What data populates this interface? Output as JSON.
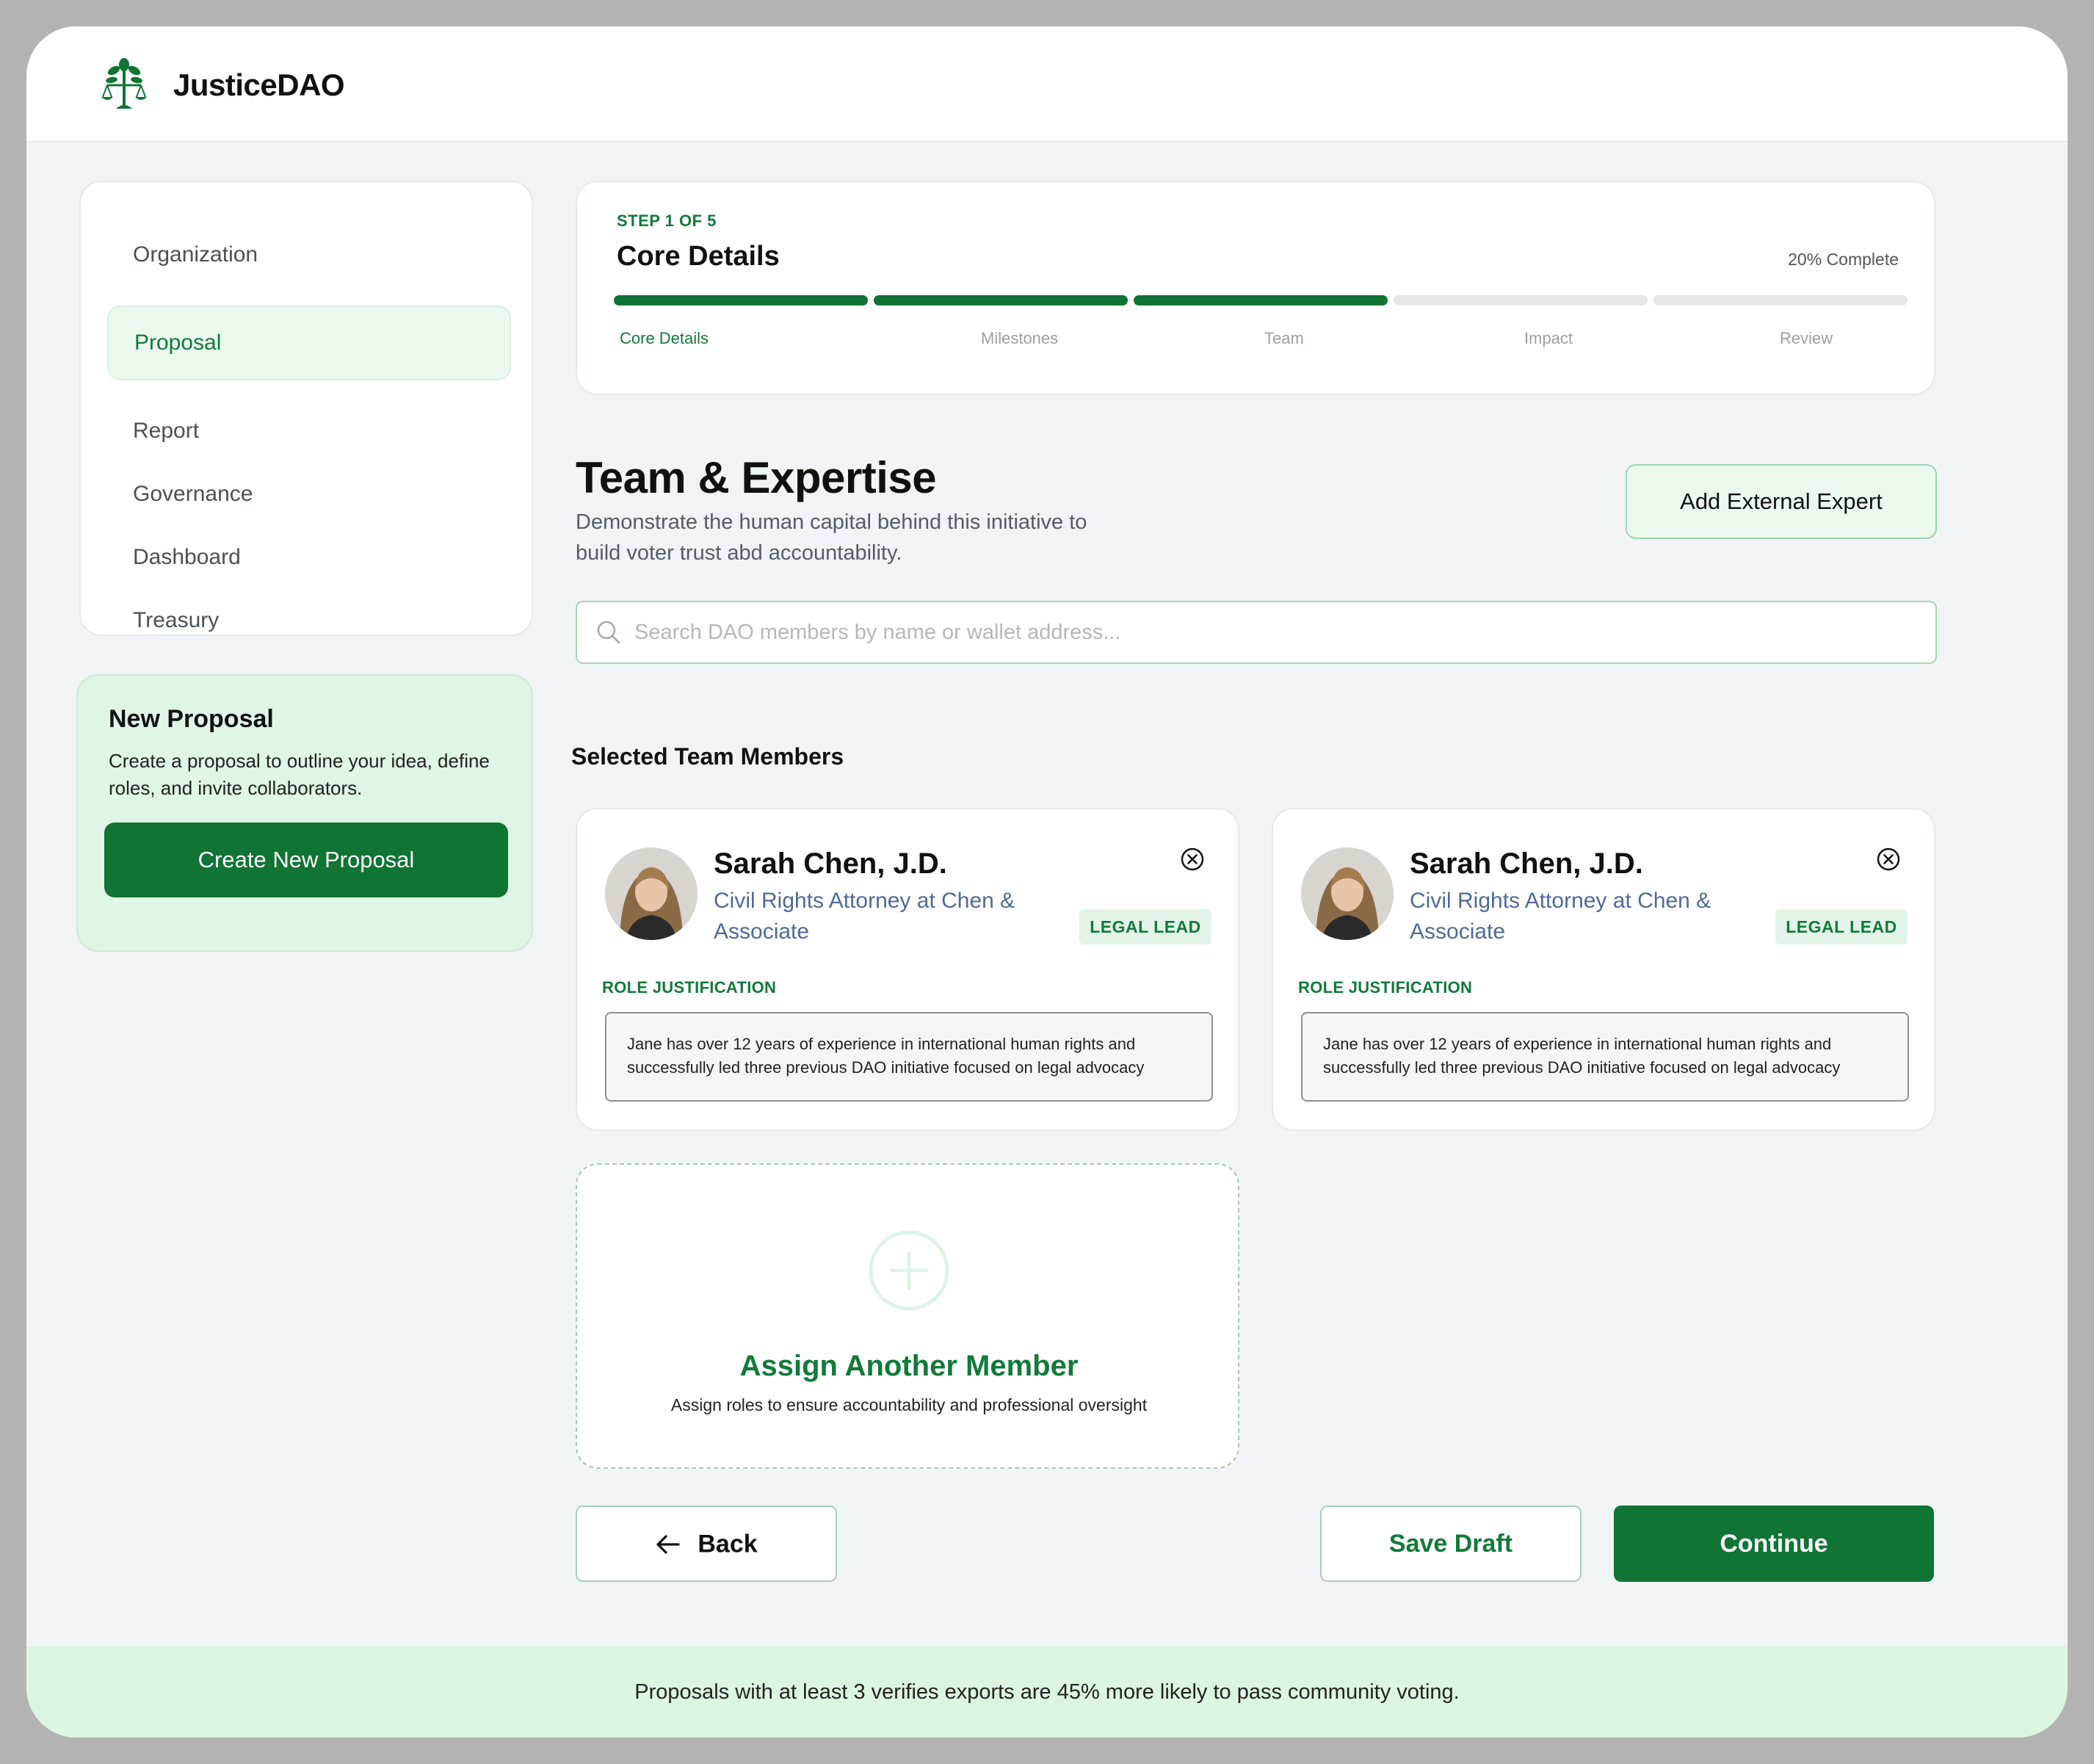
{
  "app": {
    "brand": "JusticeDAO"
  },
  "sidebar": {
    "items": [
      {
        "label": "Organization",
        "active": false
      },
      {
        "label": "Proposal",
        "active": true
      },
      {
        "label": "Report",
        "active": false
      },
      {
        "label": "Governance",
        "active": false
      },
      {
        "label": "Dashboard",
        "active": false
      },
      {
        "label": "Treasury",
        "active": false
      }
    ],
    "promo": {
      "title": "New Proposal",
      "text": "Create a proposal to outline your idea, define roles, and invite collaborators.",
      "button": "Create New Proposal"
    }
  },
  "stepper": {
    "step_label": "STEP 1 OF 5",
    "title": "Core Details",
    "percent_text": "20% Complete",
    "steps": [
      {
        "label": "Core Details",
        "done": true,
        "current": true
      },
      {
        "label": "Milestones",
        "done": true
      },
      {
        "label": "Team",
        "done": true
      },
      {
        "label": "Impact",
        "done": false
      },
      {
        "label": "Review",
        "done": false
      }
    ]
  },
  "section": {
    "title": "Team & Expertise",
    "subtitle": "Demonstrate the human capital behind this initiative to build voter trust abd accountability.",
    "add_expert": "Add External Expert"
  },
  "search": {
    "placeholder": "Search DAO members by name or wallet address..."
  },
  "members": {
    "heading": "Selected Team Members",
    "rj_label": "ROLE JUSTIFICATION",
    "list": [
      {
        "name": "Sarah Chen, J.D.",
        "title": "Civil Rights Attorney at Chen & Associate",
        "role": "LEGAL LEAD",
        "justification": "Jane has over 12 years of experience in international human rights and successfully led three previous DAO initiative focused on legal advocacy"
      },
      {
        "name": "Sarah Chen, J.D.",
        "title": "Civil Rights Attorney at Chen & Associate",
        "role": "LEGAL LEAD",
        "justification": "Jane has over 12 years of experience in international human rights and successfully led three previous DAO initiative focused on legal advocacy"
      }
    ],
    "assign": {
      "title": "Assign Another Member",
      "subtitle": "Assign roles to ensure accountability and professional oversight"
    }
  },
  "footer": {
    "back": "Back",
    "save_draft": "Save Draft",
    "continue": "Continue",
    "tip": "Proposals with at least 3 verifies exports are 45% more likely to pass community voting."
  },
  "colors": {
    "primary": "#0f7434",
    "accent_text": "#127a3a",
    "light_green": "#eaf8ee",
    "tip_bg": "#dcf5e1",
    "member_title": "#4f6a9a"
  }
}
